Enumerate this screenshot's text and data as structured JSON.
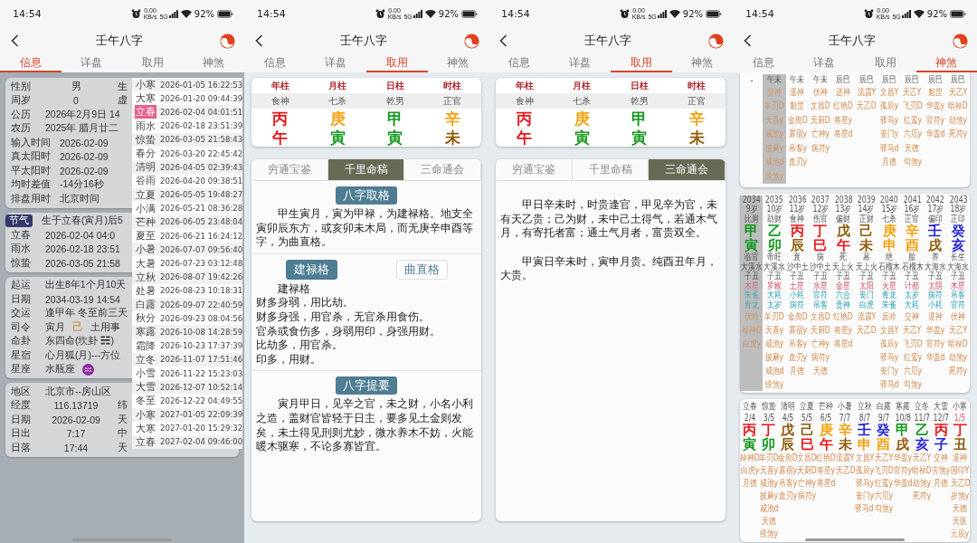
{
  "screens": [
    {
      "kind": "info",
      "home_indicator": true,
      "status_bar": {
        "time": "14:54",
        "speed": [
          "0.00",
          "KB/s"
        ],
        "network": "5G",
        "battery": "92%"
      },
      "title": "壬午八字",
      "tabs": [
        {
          "label": "信息",
          "selected": true
        },
        {
          "label": "详盘",
          "selected": false
        },
        {
          "label": "取用",
          "selected": false
        },
        {
          "label": "神煞",
          "selected": false
        }
      ],
      "cards": [
        {
          "rows": [
            {
              "kind": "columns",
              "cells": [
                "性别",
                "男",
                "生"
              ]
            },
            {
              "kind": "columns",
              "cells": [
                "周岁",
                "0",
                "虚"
              ]
            },
            {
              "kind": "pair",
              "cells": [
                "公历",
                "2026年2月9日 14"
              ]
            },
            {
              "kind": "pair",
              "cells": [
                "农历",
                "2025年 腊月廿二"
              ]
            },
            {
              "kind": "pair",
              "cells": [
                "输入时间",
                "2026-02-09"
              ]
            },
            {
              "kind": "pair",
              "cells": [
                "真太阳时",
                "2026-02-09"
              ]
            },
            {
              "kind": "pair",
              "cells": [
                "平太阳时",
                "2026-02-09"
              ]
            },
            {
              "kind": "pair",
              "cells": [
                "均时差值",
                "-14分16秒"
              ]
            },
            {
              "kind": "pair",
              "cells": [
                "排盘用时",
                "北京时间"
              ]
            }
          ]
        },
        {
          "rows": [
            {
              "kind": "badge",
              "cells": [
                "节气",
                "生于立春(寅月)后5"
              ]
            },
            {
              "kind": "pair",
              "cells": [
                "立春",
                "2026-02-04 04:0"
              ]
            },
            {
              "kind": "pair",
              "cells": [
                "雨水",
                "2026-02-18 23:51"
              ]
            },
            {
              "kind": "pair",
              "cells": [
                "惊蛰",
                "2026-03-05 21:58"
              ]
            }
          ]
        },
        {
          "rows": [
            {
              "kind": "pair",
              "cells": [
                "起运",
                "出生8年1个月10天"
              ]
            },
            {
              "kind": "pair",
              "cells": [
                "日期",
                "2034-03-19 14:54"
              ]
            },
            {
              "kind": "pair",
              "cells": [
                "交运",
                "逢甲年 冬至前三天"
              ]
            },
            {
              "kind": "pair",
              "cells": [
                "司令",
                "寅月",
                {
                  "text": "己",
                  "color": "#c9a25f"
                },
                "土用事"
              ]
            },
            {
              "kind": "pair",
              "cells": [
                "命卦",
                "东四命(坎卦 ☵)"
              ]
            },
            {
              "kind": "pair",
              "cells": [
                "星宿",
                "心月狐(月)---方位"
              ]
            },
            {
              "kind": "pair",
              "symbol": true,
              "cells": [
                "星座",
                "水瓶座"
              ]
            }
          ]
        },
        {
          "rows": [
            {
              "kind": "pair",
              "cells": [
                "地区",
                "北京市--房山区"
              ]
            },
            {
              "kind": "columns",
              "cells": [
                "经度",
                "116.13719",
                "纬"
              ]
            },
            {
              "kind": "columns",
              "cells": [
                "日期",
                "2026-02-09",
                "天"
              ]
            },
            {
              "kind": "columns",
              "cells": [
                "日出",
                "7:17",
                "中"
              ]
            },
            {
              "kind": "columns",
              "cells": [
                "日落",
                "17:44",
                "天"
              ]
            }
          ]
        }
      ],
      "popup": [
        {
          "term": "小寒",
          "time": "2026-01-05 16:22:53",
          "selected": false
        },
        {
          "term": "大寒",
          "time": "2026-01-20 09:44:39",
          "selected": false
        },
        {
          "term": "立春",
          "time": "2026-02-04 04:01:51",
          "selected": true
        },
        {
          "term": "雨水",
          "time": "2026-02-18 23:51:39",
          "selected": false
        },
        {
          "term": "惊蛰",
          "time": "2026-03-05 21:58:43",
          "selected": false
        },
        {
          "term": "春分",
          "time": "2026-03-20 22:45:42",
          "selected": false
        },
        {
          "term": "清明",
          "time": "2026-04-05 02:39:43",
          "selected": false
        },
        {
          "term": "谷雨",
          "time": "2026-04-20 09:38:51",
          "selected": false
        },
        {
          "term": "立夏",
          "time": "2026-05-05 19:48:27",
          "selected": false
        },
        {
          "term": "小满",
          "time": "2026-05-21 08:36:28",
          "selected": false
        },
        {
          "term": "芒种",
          "time": "2026-06-05 23:48:04",
          "selected": false
        },
        {
          "term": "夏至",
          "time": "2026-06-21 16:24:12",
          "selected": false
        },
        {
          "term": "小暑",
          "time": "2026-07-07 09:56:40",
          "selected": false
        },
        {
          "term": "大暑",
          "time": "2026-07-23 03:12:48",
          "selected": false
        },
        {
          "term": "立秋",
          "time": "2026-08-07 19:42:26",
          "selected": false
        },
        {
          "term": "处暑",
          "time": "2026-08-23 10:18:31",
          "selected": false
        },
        {
          "term": "白露",
          "time": "2026-09-07 22:40:59",
          "selected": false
        },
        {
          "term": "秋分",
          "time": "2026-09-23 08:04:56",
          "selected": false
        },
        {
          "term": "寒露",
          "time": "2026-10-08 14:28:59",
          "selected": false
        },
        {
          "term": "霜降",
          "time": "2026-10-23 17:37:39",
          "selected": false
        },
        {
          "term": "立冬",
          "time": "2026-11-07 17:51:46",
          "selected": false
        },
        {
          "term": "小雪",
          "time": "2026-11-22 15:23:03",
          "selected": false
        },
        {
          "term": "大雪",
          "time": "2026-12-07 10:52:14",
          "selected": false
        },
        {
          "term": "冬至",
          "time": "2026-12-22 04:49:55",
          "selected": false
        },
        {
          "term": "小寒",
          "time": "2027-01-05 22:09:39",
          "selected": false
        },
        {
          "term": "大寒",
          "time": "2027-01-20 15:29:32",
          "selected": false
        },
        {
          "term": "立春",
          "time": "2027-02-04 09:46:00",
          "selected": false
        }
      ]
    },
    {
      "kind": "reading",
      "status_bar": {
        "time": "14:54",
        "speed": [
          "0.00",
          "KB/s"
        ],
        "network": "5G",
        "battery": "92%"
      },
      "title": "壬午八字",
      "tabs": [
        {
          "label": "信息",
          "selected": false
        },
        {
          "label": "详盘",
          "selected": false
        },
        {
          "label": "取用",
          "selected": true
        },
        {
          "label": "神煞",
          "selected": false
        }
      ],
      "pillars": [
        {
          "label": "年柱",
          "god": "食神",
          "stem": {
            "text": "丙",
            "color": "#e8161b"
          },
          "branch": {
            "text": "午",
            "color": "#e8161b"
          }
        },
        {
          "label": "月柱",
          "god": "七杀",
          "stem": {
            "text": "庚",
            "color": "#f5a20f"
          },
          "branch": {
            "text": "寅",
            "color": "#14991f"
          }
        },
        {
          "label": "日柱",
          "god": "乾男",
          "stem": {
            "text": "甲",
            "color": "#14991f"
          },
          "branch": {
            "text": "寅",
            "color": "#14991f"
          }
        },
        {
          "label": "时柱",
          "god": "正官",
          "stem": {
            "text": "辛",
            "color": "#f5a20f"
          },
          "branch": {
            "text": "未",
            "color": "#8f5d0c"
          }
        }
      ],
      "books": [
        {
          "label": "穷通宝鉴",
          "selected": false
        },
        {
          "label": "千里命稿",
          "selected": true
        },
        {
          "label": "三命通会",
          "selected": false
        }
      ],
      "groups": [
        {
          "heading": "八字取格",
          "paragraphs": [
            "甲生寅月，寅为甲禄，为建禄格。地支全寅卯辰东方，或亥卯未木局，而无庚辛申酉等字，为曲直格。"
          ]
        },
        {
          "chips": [
            {
              "label": "建禄格",
              "selected": true
            },
            {
              "label": "曲直格",
              "selected": false
            }
          ],
          "paragraphs": [
            "建禄格"
          ],
          "lines": [
            "财多身弱，用比劫。",
            "财多身强，用官杀，无官杀用食伤。",
            "官杀或食伤多，身弱用印，身强用财。",
            "比劫多，用官杀。",
            "印多，用财。"
          ]
        },
        {
          "heading": "八字提要",
          "paragraphs": [
            "寅月甲日，见辛之官，未之财，小名小利之造，盖财官皆轻于日主，要多见土金则发矣，未土得见刑则尤妙，微水养木不妨，火能暖木驱寒，不论多寡皆宜。"
          ]
        }
      ]
    },
    {
      "kind": "reading",
      "status_bar": {
        "time": "14:54",
        "speed": [
          "0.00",
          "KB/s"
        ],
        "network": "5G",
        "battery": "92%"
      },
      "title": "壬午八字",
      "tabs": [
        {
          "label": "信息",
          "selected": false
        },
        {
          "label": "详盘",
          "selected": false
        },
        {
          "label": "取用",
          "selected": true
        },
        {
          "label": "神煞",
          "selected": false
        }
      ],
      "pillars": [
        {
          "label": "年柱",
          "god": "食神",
          "stem": {
            "text": "丙",
            "color": "#e8161b"
          },
          "branch": {
            "text": "午",
            "color": "#e8161b"
          }
        },
        {
          "label": "月柱",
          "god": "七杀",
          "stem": {
            "text": "庚",
            "color": "#f5a20f"
          },
          "branch": {
            "text": "寅",
            "color": "#14991f"
          }
        },
        {
          "label": "日柱",
          "god": "乾男",
          "stem": {
            "text": "甲",
            "color": "#14991f"
          },
          "branch": {
            "text": "寅",
            "color": "#14991f"
          }
        },
        {
          "label": "时柱",
          "god": "正官",
          "stem": {
            "text": "辛",
            "color": "#f5a20f"
          },
          "branch": {
            "text": "未",
            "color": "#8f5d0c"
          }
        }
      ],
      "books": [
        {
          "label": "穷通宝鉴",
          "selected": false
        },
        {
          "label": "千里命稿",
          "selected": false
        },
        {
          "label": "三命通会",
          "selected": true
        }
      ],
      "groups": [
        {
          "paragraphs": [
            "甲日辛未时，时贵逢官，甲见辛为官，未有天乙贵；己为财，未中己土得气，若通木气月，有寄托者富；通土气月者，富贵双全。",
            "甲寅日辛未时，寅申月贵。纯酉丑年月，大贵。"
          ]
        }
      ]
    },
    {
      "kind": "shensha",
      "home_indicator": true,
      "status_bar": {
        "time": "14:54",
        "speed": [
          "0.00",
          "KB/s"
        ],
        "network": "5G",
        "battery": "92%"
      },
      "title": "壬午八字",
      "tabs": [
        {
          "label": "信息",
          "selected": false
        },
        {
          "label": "详盘",
          "selected": false
        },
        {
          "label": "取用",
          "selected": false
        },
        {
          "label": "神煞",
          "selected": true
        }
      ],
      "year_table": [
        {
          "selected": false,
          "kongwang": "-"
        },
        {
          "selected": true,
          "kongwang": "午未",
          "shensha": [
            "交神",
            "羊刃D",
            "天喜y",
            "咸池y",
            "披麻y",
            "咸池d",
            "绞煞y"
          ]
        },
        {
          "selected": false,
          "kongwang": "午未",
          "shensha": [
            "退神",
            "魁罡",
            "金舆D",
            "寡宿y",
            "吊客y",
            "血刃y"
          ]
        },
        {
          "selected": false,
          "kongwang": "午未",
          "shensha": [
            "伏神",
            "文昌D",
            "天厨D",
            "亡神y",
            "病符y"
          ]
        },
        {
          "selected": false,
          "kongwang": "辰巳",
          "shensha": [
            "进神",
            "红艳D",
            "将星y",
            "将星d"
          ]
        },
        {
          "selected": false,
          "kongwang": "辰巳",
          "shensha": [
            "流霞Y",
            "天乙D"
          ]
        },
        {
          "selected": false,
          "kongwang": "辰巳",
          "shensha": [
            "文昌Y",
            "孤辰y",
            "驿马y",
            "丧门y",
            "驿马d",
            "月德"
          ]
        },
        {
          "selected": false,
          "kongwang": "辰巳",
          "shensha": [
            "天乙Y",
            "飞刃D",
            "红鸾y",
            "六厄y",
            "天德",
            "勾煞y"
          ]
        },
        {
          "selected": false,
          "kongwang": "辰巳",
          "shensha": [
            "魁罡",
            "华盖y",
            "官符y",
            "华盖d"
          ]
        },
        {
          "selected": false,
          "kongwang": "辰巳",
          "shensha": [
            "天乙Y",
            "暗禄D",
            "劫煞y",
            "死符y"
          ]
        }
      ],
      "dayun_table": [
        {
          "selected": true,
          "year": "2034",
          "age": "9岁",
          "god": "比肩",
          "stem": {
            "text": "甲",
            "color": "#14991f"
          },
          "branch": {
            "text": "寅",
            "color": "#14991f"
          },
          "stage": "临官",
          "nayin": "大溪水",
          "kongwang": "子丑",
          "star": "木星",
          "god1": "朱雀",
          "god2": "青龙",
          "shensha": [
            "伏吟",
            "禄神D",
            "白虎y"
          ]
        },
        {
          "selected": false,
          "year": "2035",
          "age": "10岁",
          "god": "劫财",
          "stem": {
            "text": "乙",
            "color": "#14991f"
          },
          "branch": {
            "text": "卯",
            "color": "#14991f"
          },
          "stage": "帝旺",
          "nayin": "大溪水",
          "kongwang": "子丑",
          "star": "罗睺",
          "god1": "大耗",
          "god2": "太岁",
          "shensha": [
            "羊刃D",
            "天喜y",
            "咸池y",
            "披麻y",
            "咸池d",
            "绞煞y"
          ]
        },
        {
          "selected": false,
          "year": "2036",
          "age": "11岁",
          "god": "食神",
          "stem": {
            "text": "丙",
            "color": "#e8161b"
          },
          "branch": {
            "text": "辰",
            "color": "#8f5d0c"
          },
          "stage": "衰",
          "nayin": "沙中土",
          "kongwang": "子丑",
          "star": "土星",
          "god1": "小耗",
          "god2": "病符",
          "shensha": [
            "金舆D",
            "寡宿y",
            "吊客y",
            "血刃y",
            "月德"
          ]
        },
        {
          "selected": false,
          "year": "2037",
          "age": "12岁",
          "god": "伤官",
          "stem": {
            "text": "丁",
            "color": "#e8161b"
          },
          "branch": {
            "text": "巳",
            "color": "#e8161b"
          },
          "stage": "病",
          "nayin": "沙中土",
          "kongwang": "子丑",
          "star": "水星",
          "god1": "官符",
          "god2": "吊客",
          "shensha": [
            "文昌D",
            "天厨D",
            "亡神y",
            "病符y",
            "天德"
          ]
        },
        {
          "selected": false,
          "year": "2038",
          "age": "13岁",
          "god": "偏财",
          "stem": {
            "text": "戊",
            "color": "#8f5d0c"
          },
          "branch": {
            "text": "午",
            "color": "#e8161b"
          },
          "stage": "死",
          "nayin": "天上火",
          "kongwang": "子丑",
          "star": "金星",
          "god1": "六合",
          "god2": "贵神",
          "shensha": [
            "红艳D",
            "将星y",
            "将星d"
          ]
        },
        {
          "selected": false,
          "year": "2039",
          "age": "14岁",
          "god": "正财",
          "stem": {
            "text": "己",
            "color": "#8f5d0c"
          },
          "branch": {
            "text": "未",
            "color": "#8f5d0c"
          },
          "stage": "墓",
          "nayin": "天上火",
          "kongwang": "子丑",
          "star": "太阳",
          "god1": "丧门",
          "god2": "白虎",
          "shensha": [
            "流霞Y",
            "天乙D"
          ]
        },
        {
          "selected": false,
          "year": "2040",
          "age": "15岁",
          "god": "七杀",
          "stem": {
            "text": "庚",
            "color": "#f5a20f"
          },
          "branch": {
            "text": "申",
            "color": "#f5a20f"
          },
          "stage": "绝",
          "nayin": "石榴木",
          "kongwang": "子丑",
          "star": "火星",
          "god1": "青龙",
          "god2": "朱雀",
          "shensha": [
            "反吟",
            "文昌Y",
            "孤辰y",
            "驿马y",
            "丧门y",
            "驿马d"
          ]
        },
        {
          "selected": false,
          "year": "2041",
          "age": "16岁",
          "god": "正官",
          "stem": {
            "text": "辛",
            "color": "#f5a20f"
          },
          "branch": {
            "text": "酉",
            "color": "#f5a20f"
          },
          "stage": "胎",
          "nayin": "石榴木",
          "kongwang": "子丑",
          "star": "计都",
          "god1": "太岁",
          "god2": "大耗",
          "shensha": [
            "交神",
            "天乙Y",
            "飞刃D",
            "红鸾y",
            "六厄y",
            "勾煞y"
          ]
        },
        {
          "selected": false,
          "year": "2042",
          "age": "17岁",
          "god": "偏印",
          "stem": {
            "text": "壬",
            "color": "#2323d8"
          },
          "branch": {
            "text": "戌",
            "color": "#8f5d0c"
          },
          "stage": "养",
          "nayin": "大海水",
          "kongwang": "子丑",
          "star": "太阴",
          "god1": "病符",
          "god2": "小耗",
          "shensha": [
            "退神",
            "华盖y",
            "官符y",
            "华盖d"
          ]
        },
        {
          "selected": false,
          "year": "2043",
          "age": "18岁",
          "god": "正印",
          "stem": {
            "text": "癸",
            "color": "#2323d8"
          },
          "branch": {
            "text": "亥",
            "color": "#2323d8"
          },
          "stage": "长生",
          "nayin": "大海水",
          "kongwang": "子丑",
          "star": "木星",
          "god1": "吊客",
          "god2": "官符",
          "shensha": [
            "伏神",
            "天乙Y",
            "暗禄D",
            "劫煞y",
            "死符y"
          ]
        }
      ],
      "month_table": [
        {
          "term": "立春",
          "date": "2/4",
          "flagged": false,
          "stem": {
            "text": "丙",
            "color": "#e8161b"
          },
          "branch": {
            "text": "寅",
            "color": "#14991f"
          },
          "shensha": [
            "禄神D",
            "白虎y",
            "月德"
          ]
        },
        {
          "term": "惊蛰",
          "date": "3/5",
          "flagged": false,
          "stem": {
            "text": "丁",
            "color": "#e8161b"
          },
          "branch": {
            "text": "卯",
            "color": "#14991f"
          },
          "shensha": [
            "羊刃D",
            "天喜y",
            "咸池y",
            "披麻y",
            "咸池d",
            "天德",
            "绞煞y"
          ]
        },
        {
          "term": "清明",
          "date": "4/5",
          "flagged": false,
          "stem": {
            "text": "戊",
            "color": "#8f5d0c"
          },
          "branch": {
            "text": "辰",
            "color": "#8f5d0c"
          },
          "shensha": [
            "金舆D",
            "寡宿y",
            "吊客y",
            "血刃y"
          ]
        },
        {
          "term": "立夏",
          "date": "5/5",
          "flagged": false,
          "stem": {
            "text": "己",
            "color": "#8f5d0c"
          },
          "branch": {
            "text": "巳",
            "color": "#e8161b"
          },
          "shensha": [
            "文昌D",
            "天厨D",
            "亡神y",
            "病符y"
          ]
        },
        {
          "term": "芒种",
          "date": "6/5",
          "flagged": false,
          "stem": {
            "text": "庚",
            "color": "#f5a20f"
          },
          "branch": {
            "text": "午",
            "color": "#e8161b"
          },
          "shensha": [
            "红艳D",
            "将星y",
            "将星d"
          ]
        },
        {
          "term": "小暑",
          "date": "7/7",
          "flagged": false,
          "stem": {
            "text": "辛",
            "color": "#f5a20f"
          },
          "branch": {
            "text": "未",
            "color": "#8f5d0c"
          },
          "shensha": [
            "流霞Y",
            "天乙D"
          ]
        },
        {
          "term": "立秋",
          "date": "8/7",
          "flagged": false,
          "stem": {
            "text": "壬",
            "color": "#2323d8"
          },
          "branch": {
            "text": "申",
            "color": "#f5a20f"
          },
          "shensha": [
            "文昌Y",
            "孤辰y",
            "驿马y",
            "丧门y",
            "驿马d"
          ]
        },
        {
          "term": "白露",
          "date": "9/7",
          "flagged": false,
          "stem": {
            "text": "癸",
            "color": "#2323d8"
          },
          "branch": {
            "text": "酉",
            "color": "#f5a20f"
          },
          "shensha": [
            "天乙Y",
            "飞刃D",
            "红鸾y",
            "六厄y",
            "勾煞y"
          ]
        },
        {
          "term": "寒露",
          "date": "10/8",
          "flagged": false,
          "stem": {
            "text": "甲",
            "color": "#14991f"
          },
          "branch": {
            "text": "戌",
            "color": "#8f5d0c"
          },
          "shensha": [
            "华盖y",
            "官符y",
            "华盖d"
          ]
        },
        {
          "term": "立冬",
          "date": "11/7",
          "flagged": false,
          "stem": {
            "text": "乙",
            "color": "#14991f"
          },
          "branch": {
            "text": "亥",
            "color": "#2323d8"
          },
          "shensha": [
            "天乙Y",
            "暗禄D",
            "劫煞y",
            "死符y"
          ]
        },
        {
          "term": "大雪",
          "date": "12/7",
          "flagged": false,
          "stem": {
            "text": "丙",
            "color": "#e8161b"
          },
          "branch": {
            "text": "子",
            "color": "#2323d8"
          },
          "shensha": [
            "交神",
            "灾煞y",
            "月德"
          ]
        },
        {
          "term": "小寒",
          "date": "1/5",
          "flagged": true,
          "stem": {
            "text": "丁",
            "color": "#e8161b"
          },
          "branch": {
            "text": "丑",
            "color": "#8f5d0c"
          },
          "shensha": [
            "退神",
            "国印Y",
            "天乙D",
            "岁煞y",
            "天德",
            "天医",
            "元辰y"
          ]
        }
      ]
    }
  ]
}
